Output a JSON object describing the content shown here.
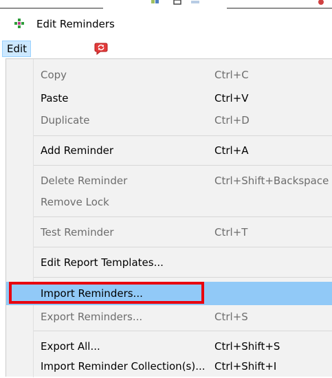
{
  "window": {
    "title": "Edit Reminders",
    "app_icon": "green-diamond-plus-icon"
  },
  "menubar": {
    "active_menu_label": "Edit",
    "extra_icon": "red-speech-bubble-reminder-icon"
  },
  "menu": {
    "items": [
      {
        "label": "Copy",
        "shortcut": "Ctrl+C",
        "enabled": false
      },
      {
        "label": "Paste",
        "shortcut": "Ctrl+V",
        "enabled": true
      },
      {
        "label": "Duplicate",
        "shortcut": "Ctrl+D",
        "enabled": false
      },
      {
        "label": "Add Reminder",
        "shortcut": "Ctrl+A",
        "enabled": true
      },
      {
        "label": "Delete Reminder",
        "shortcut": "Ctrl+Shift+Backspace",
        "enabled": false
      },
      {
        "label": "Remove Lock",
        "shortcut": "",
        "enabled": false
      },
      {
        "label": "Test Reminder",
        "shortcut": "Ctrl+T",
        "enabled": false
      },
      {
        "label": "Edit Report Templates...",
        "shortcut": "",
        "enabled": true
      },
      {
        "label": "Import Reminders...",
        "shortcut": "",
        "enabled": true,
        "highlighted": true
      },
      {
        "label": "Export Reminders...",
        "shortcut": "Ctrl+S",
        "enabled": false
      },
      {
        "label": "Export All...",
        "shortcut": "Ctrl+Shift+S",
        "enabled": true
      },
      {
        "label": "Import Reminder Collection(s)...",
        "shortcut": "Ctrl+Shift+I",
        "enabled": true
      }
    ]
  },
  "colors": {
    "highlight": "#91c9f7",
    "menu_background": "#f2f2f2",
    "annotation_border": "#e8000e",
    "menubar_active": "#cce8ff"
  }
}
